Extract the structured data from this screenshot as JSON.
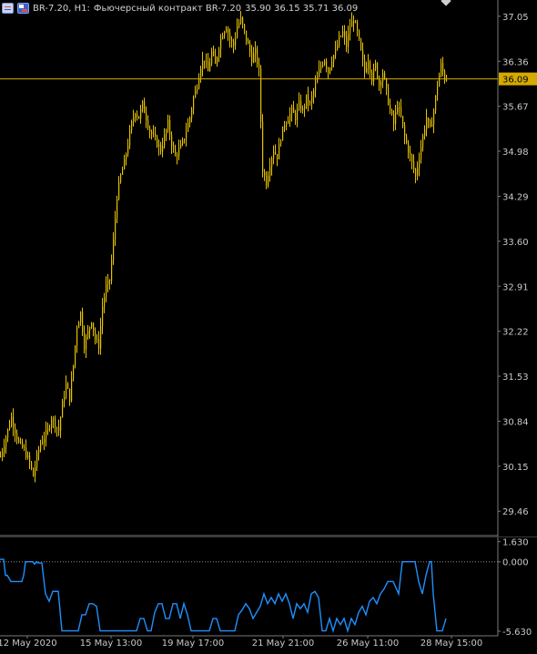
{
  "header": {
    "symbol": "BR-7.20, H1:",
    "description": "Фьючерсный контракт BR-7.20",
    "ohlc": "35.90 36.15 35.71 36.09"
  },
  "colors": {
    "background": "#000000",
    "candle": "#e6c200",
    "price_line": "#d4aa00",
    "indicator": "#1e90ff",
    "axis_text": "#c8c8c8",
    "axis_line": "#7a7a7a"
  },
  "chart_data": [
    {
      "type": "candlestick",
      "title": "BR-7.20, H1",
      "y_ticks": [
        "37.05",
        "36.36",
        "35.67",
        "34.98",
        "34.29",
        "33.60",
        "32.91",
        "32.22",
        "31.53",
        "30.84",
        "30.15",
        "29.46"
      ],
      "ylim": [
        29.1,
        37.3
      ],
      "current_price": "36.09",
      "x_ticks": [
        "12 May 2020",
        "15 May 13:00",
        "19 May 17:00",
        "21 May 21:00",
        "26 May 11:00",
        "28 May 15:00"
      ],
      "close_path": [
        [
          0,
          30.3
        ],
        [
          6,
          30.6
        ],
        [
          12,
          30.9
        ],
        [
          16,
          30.7
        ],
        [
          20,
          30.5
        ],
        [
          26,
          30.4
        ],
        [
          32,
          30.2
        ],
        [
          36,
          30.0
        ],
        [
          40,
          30.3
        ],
        [
          44,
          30.5
        ],
        [
          48,
          30.6
        ],
        [
          52,
          30.7
        ],
        [
          56,
          30.9
        ],
        [
          60,
          30.8
        ],
        [
          64,
          30.7
        ],
        [
          68,
          31.1
        ],
        [
          72,
          31.4
        ],
        [
          76,
          31.2
        ],
        [
          80,
          31.7
        ],
        [
          84,
          32.3
        ],
        [
          88,
          32.5
        ],
        [
          92,
          32.0
        ],
        [
          96,
          32.2
        ],
        [
          100,
          32.4
        ],
        [
          104,
          32.1
        ],
        [
          108,
          32.0
        ],
        [
          112,
          32.6
        ],
        [
          116,
          32.9
        ],
        [
          120,
          33.0
        ],
        [
          124,
          33.6
        ],
        [
          128,
          34.3
        ],
        [
          132,
          34.6
        ],
        [
          136,
          34.8
        ],
        [
          140,
          35.1
        ],
        [
          144,
          35.4
        ],
        [
          148,
          35.6
        ],
        [
          152,
          35.5
        ],
        [
          156,
          35.7
        ],
        [
          160,
          35.5
        ],
        [
          164,
          35.3
        ],
        [
          168,
          35.2
        ],
        [
          172,
          35.1
        ],
        [
          176,
          35.0
        ],
        [
          180,
          35.2
        ],
        [
          184,
          35.4
        ],
        [
          188,
          35.1
        ],
        [
          192,
          34.9
        ],
        [
          196,
          35.0
        ],
        [
          200,
          35.1
        ],
        [
          204,
          35.3
        ],
        [
          208,
          35.5
        ],
        [
          212,
          35.8
        ],
        [
          216,
          36.0
        ],
        [
          220,
          36.3
        ],
        [
          224,
          36.4
        ],
        [
          228,
          36.2
        ],
        [
          232,
          36.5
        ],
        [
          236,
          36.3
        ],
        [
          240,
          36.6
        ],
        [
          244,
          36.8
        ],
        [
          248,
          36.9
        ],
        [
          252,
          36.7
        ],
        [
          256,
          36.6
        ],
        [
          260,
          36.9
        ],
        [
          264,
          37.0
        ],
        [
          268,
          36.8
        ],
        [
          272,
          36.6
        ],
        [
          276,
          36.4
        ],
        [
          280,
          36.5
        ],
        [
          284,
          36.2
        ],
        [
          288,
          34.7
        ],
        [
          292,
          34.5
        ],
        [
          296,
          34.8
        ],
        [
          300,
          35.0
        ],
        [
          304,
          34.9
        ],
        [
          308,
          35.2
        ],
        [
          312,
          35.4
        ],
        [
          316,
          35.5
        ],
        [
          320,
          35.6
        ],
        [
          324,
          35.5
        ],
        [
          328,
          35.7
        ],
        [
          332,
          35.6
        ],
        [
          336,
          35.8
        ],
        [
          340,
          35.7
        ],
        [
          344,
          35.9
        ],
        [
          348,
          36.1
        ],
        [
          352,
          36.3
        ],
        [
          356,
          36.4
        ],
        [
          360,
          36.2
        ],
        [
          364,
          36.4
        ],
        [
          368,
          36.5
        ],
        [
          372,
          36.7
        ],
        [
          376,
          36.8
        ],
        [
          380,
          36.6
        ],
        [
          384,
          36.9
        ],
        [
          388,
          37.0
        ],
        [
          392,
          36.8
        ],
        [
          396,
          36.5
        ],
        [
          400,
          36.2
        ],
        [
          404,
          36.4
        ],
        [
          408,
          36.1
        ],
        [
          412,
          36.3
        ],
        [
          416,
          36.0
        ],
        [
          420,
          36.2
        ],
        [
          424,
          35.9
        ],
        [
          428,
          35.6
        ],
        [
          432,
          35.4
        ],
        [
          436,
          35.7
        ],
        [
          440,
          35.5
        ],
        [
          444,
          35.2
        ],
        [
          448,
          35.0
        ],
        [
          452,
          34.8
        ],
        [
          456,
          34.6
        ],
        [
          460,
          34.9
        ],
        [
          464,
          35.2
        ],
        [
          468,
          35.5
        ],
        [
          472,
          35.3
        ],
        [
          476,
          35.6
        ],
        [
          480,
          36.0
        ],
        [
          484,
          36.3
        ],
        [
          488,
          36.1
        ],
        [
          491,
          36.09
        ]
      ]
    },
    {
      "type": "line",
      "y_ticks": [
        "1.630",
        "0.000",
        "-5.630"
      ],
      "ylim": [
        -6.0,
        1.9
      ],
      "points": [
        [
          0,
          0.2
        ],
        [
          4,
          0.2
        ],
        [
          6,
          -1.1
        ],
        [
          8,
          -1.1
        ],
        [
          12,
          -1.6
        ],
        [
          24,
          -1.6
        ],
        [
          26,
          -1.1
        ],
        [
          28,
          0.0
        ],
        [
          36,
          0.0
        ],
        [
          38,
          -0.2
        ],
        [
          40,
          0.0
        ],
        [
          42,
          -0.1
        ],
        [
          46,
          -0.1
        ],
        [
          50,
          -2.6
        ],
        [
          54,
          -3.2
        ],
        [
          58,
          -2.4
        ],
        [
          64,
          -2.4
        ],
        [
          68,
          -5.6
        ],
        [
          86,
          -5.6
        ],
        [
          90,
          -4.3
        ],
        [
          94,
          -4.3
        ],
        [
          98,
          -3.4
        ],
        [
          102,
          -3.4
        ],
        [
          106,
          -3.6
        ],
        [
          110,
          -5.6
        ],
        [
          150,
          -5.6
        ],
        [
          154,
          -4.6
        ],
        [
          158,
          -4.6
        ],
        [
          162,
          -5.6
        ],
        [
          166,
          -5.6
        ],
        [
          170,
          -4.1
        ],
        [
          174,
          -3.4
        ],
        [
          178,
          -3.4
        ],
        [
          182,
          -4.6
        ],
        [
          186,
          -4.6
        ],
        [
          190,
          -3.4
        ],
        [
          194,
          -3.4
        ],
        [
          198,
          -4.6
        ],
        [
          202,
          -3.4
        ],
        [
          206,
          -4.3
        ],
        [
          210,
          -5.6
        ],
        [
          230,
          -5.6
        ],
        [
          234,
          -4.6
        ],
        [
          238,
          -4.6
        ],
        [
          242,
          -5.6
        ],
        [
          258,
          -5.6
        ],
        [
          262,
          -4.3
        ],
        [
          266,
          -3.9
        ],
        [
          270,
          -3.4
        ],
        [
          274,
          -3.8
        ],
        [
          278,
          -4.6
        ],
        [
          282,
          -4.1
        ],
        [
          286,
          -3.6
        ],
        [
          290,
          -2.6
        ],
        [
          294,
          -3.4
        ],
        [
          298,
          -2.9
        ],
        [
          302,
          -3.4
        ],
        [
          306,
          -2.6
        ],
        [
          310,
          -3.2
        ],
        [
          314,
          -2.6
        ],
        [
          318,
          -3.4
        ],
        [
          322,
          -4.6
        ],
        [
          326,
          -3.4
        ],
        [
          330,
          -3.8
        ],
        [
          334,
          -3.4
        ],
        [
          338,
          -4.1
        ],
        [
          342,
          -2.6
        ],
        [
          346,
          -2.4
        ],
        [
          350,
          -2.9
        ],
        [
          354,
          -5.6
        ],
        [
          358,
          -5.6
        ],
        [
          362,
          -4.6
        ],
        [
          366,
          -5.6
        ],
        [
          370,
          -4.6
        ],
        [
          374,
          -5.1
        ],
        [
          378,
          -4.6
        ],
        [
          382,
          -5.6
        ],
        [
          386,
          -4.6
        ],
        [
          390,
          -5.1
        ],
        [
          394,
          -4.1
        ],
        [
          398,
          -3.6
        ],
        [
          402,
          -4.3
        ],
        [
          406,
          -3.2
        ],
        [
          410,
          -2.9
        ],
        [
          414,
          -3.4
        ],
        [
          418,
          -2.6
        ],
        [
          422,
          -2.2
        ],
        [
          426,
          -1.6
        ],
        [
          432,
          -1.6
        ],
        [
          438,
          -2.6
        ],
        [
          442,
          0.0
        ],
        [
          456,
          0.0
        ],
        [
          460,
          -1.6
        ],
        [
          464,
          -2.6
        ],
        [
          468,
          -1.1
        ],
        [
          472,
          0.0
        ],
        [
          474,
          0.0
        ],
        [
          476,
          -2.6
        ],
        [
          480,
          -5.6
        ],
        [
          486,
          -5.6
        ],
        [
          490,
          -4.6
        ]
      ]
    }
  ]
}
